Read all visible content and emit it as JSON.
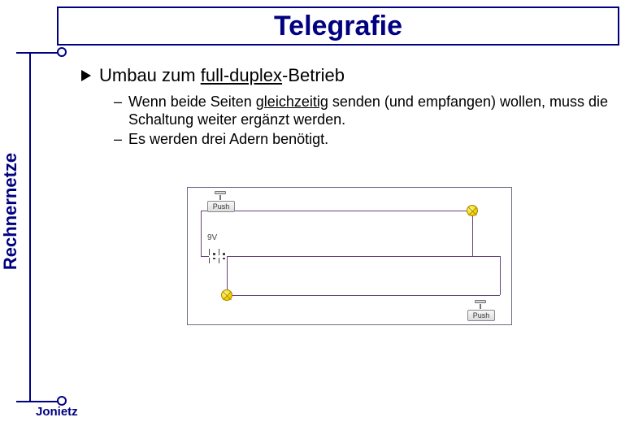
{
  "title": "Telegrafie",
  "side_label": "Rechnernetze",
  "footer": "Jonietz",
  "bullet": {
    "prefix": "Umbau zum ",
    "underlined": "full-duplex",
    "suffix": "-Betrieb"
  },
  "sub_items": [
    {
      "pre": "Wenn beide Seiten ",
      "underlined": "gleichzeitig",
      "post": " senden (und empfangen) wollen, muss die Schaltung weiter ergänzt werden."
    },
    {
      "pre": "Es werden drei Adern benötigt.",
      "underlined": "",
      "post": ""
    }
  ],
  "diagram": {
    "push_label": "Push",
    "voltage_label": "9V"
  }
}
